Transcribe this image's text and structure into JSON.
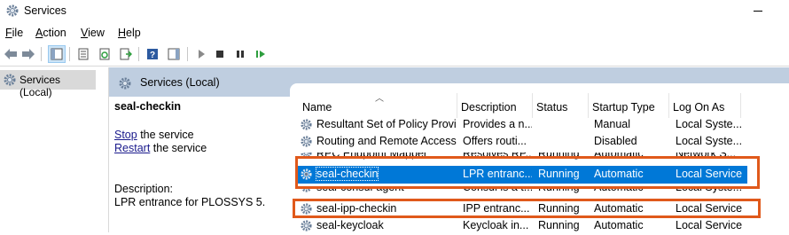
{
  "window": {
    "title": "Services"
  },
  "menu": [
    {
      "label": "File",
      "u": "F",
      "rest": "ile"
    },
    {
      "label": "Action",
      "u": "A",
      "rest": "ction"
    },
    {
      "label": "View",
      "u": "V",
      "rest": "iew"
    },
    {
      "label": "Help",
      "u": "H",
      "rest": "elp"
    }
  ],
  "toolbar": {
    "icons": [
      "back-arrow-icon",
      "forward-arrow-icon",
      "show-console-tree-icon",
      "properties-icon",
      "refresh-icon",
      "export-list-icon",
      "help-icon",
      "show-hide-action-pane-icon",
      "start-service-icon",
      "stop-service-icon",
      "pause-service-icon",
      "resume-service-icon"
    ]
  },
  "tree": {
    "root_label": "Services (Local)"
  },
  "header": {
    "title": "Services (Local)"
  },
  "details": {
    "service_name": "seal-checkin",
    "stop_link": "Stop",
    "stop_suffix": " the service",
    "restart_link": "Restart",
    "restart_suffix": " the service",
    "description_label": "Description:",
    "description_text": "LPR entrance for PLOSSYS 5."
  },
  "columns": [
    "Name",
    "Description",
    "Status",
    "Startup Type",
    "Log On As"
  ],
  "rows": [
    {
      "name": "Resultant Set of Policy Provi...",
      "description": "Provides a n...",
      "status": "",
      "startup": "Manual",
      "logon": "Local Syste..."
    },
    {
      "name": "Routing and Remote Access",
      "description": "Offers routi...",
      "status": "",
      "startup": "Disabled",
      "logon": "Local Syste..."
    },
    {
      "name": "RPC Endpoint Mapper",
      "description": "Resolves RP...",
      "status": "Running",
      "startup": "Automatic",
      "logon": "Network S..."
    },
    {
      "name": "seal-checkin",
      "description": "LPR entranc...",
      "status": "Running",
      "startup": "Automatic",
      "logon": "Local Service"
    },
    {
      "name": "seal-consul-agent",
      "description": "Consul is a t...",
      "status": "Running",
      "startup": "Automatic",
      "logon": "Local Syste..."
    },
    {
      "name": "seal-ipp-checkin",
      "description": "IPP entranc...",
      "status": "Running",
      "startup": "Automatic",
      "logon": "Local Service"
    },
    {
      "name": "seal-keycloak",
      "description": "Keycloak in...",
      "status": "Running",
      "startup": "Automatic",
      "logon": "Local Service"
    }
  ],
  "colors": {
    "selection": "#0078d7",
    "highlight_box": "#e0591b",
    "header_band": "#bfcee0"
  }
}
